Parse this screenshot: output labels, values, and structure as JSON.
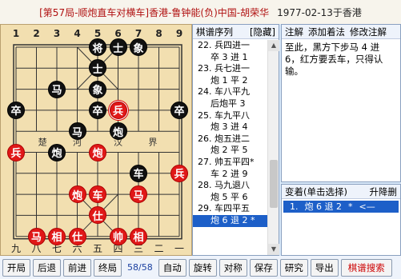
{
  "title": {
    "game": "[第57局-顺炮直车对横车]香港-鲁钟能(负)中国-胡荣华",
    "date": "1977-02-13于香港"
  },
  "board": {
    "file_labels_top": [
      "1",
      "2",
      "3",
      "4",
      "5",
      "6",
      "7",
      "8",
      "9"
    ],
    "file_labels_bottom": [
      "九",
      "八",
      "七",
      "六",
      "五",
      "四",
      "三",
      "二",
      "一"
    ],
    "river_left": [
      "楚",
      "河"
    ],
    "river_right": [
      "汉",
      "界"
    ],
    "pieces": [
      {
        "char": "将",
        "side": "black",
        "col": 4,
        "row": 0
      },
      {
        "char": "士",
        "side": "black",
        "col": 5,
        "row": 0
      },
      {
        "char": "象",
        "side": "black",
        "col": 6,
        "row": 0
      },
      {
        "char": "士",
        "side": "black",
        "col": 4,
        "row": 1
      },
      {
        "char": "马",
        "side": "black",
        "col": 2,
        "row": 2
      },
      {
        "char": "象",
        "side": "black",
        "col": 4,
        "row": 2
      },
      {
        "char": "卒",
        "side": "black",
        "col": 0,
        "row": 3
      },
      {
        "char": "卒",
        "side": "black",
        "col": 4,
        "row": 3
      },
      {
        "char": "兵",
        "side": "red",
        "col": 5,
        "row": 3,
        "last": true
      },
      {
        "char": "卒",
        "side": "black",
        "col": 8,
        "row": 3
      },
      {
        "char": "马",
        "side": "black",
        "col": 3,
        "row": 4
      },
      {
        "char": "炮",
        "side": "black",
        "col": 5,
        "row": 4
      },
      {
        "char": "兵",
        "side": "red",
        "col": 0,
        "row": 5
      },
      {
        "char": "炮",
        "side": "black",
        "col": 2,
        "row": 5
      },
      {
        "char": "炮",
        "side": "red",
        "col": 4,
        "row": 5
      },
      {
        "char": "车",
        "side": "black",
        "col": 6,
        "row": 6
      },
      {
        "char": "兵",
        "side": "red",
        "col": 8,
        "row": 6
      },
      {
        "char": "炮",
        "side": "red",
        "col": 3,
        "row": 7
      },
      {
        "char": "车",
        "side": "red",
        "col": 4,
        "row": 7
      },
      {
        "char": "马",
        "side": "red",
        "col": 6,
        "row": 7
      },
      {
        "char": "仕",
        "side": "red",
        "col": 4,
        "row": 8
      },
      {
        "char": "马",
        "side": "red",
        "col": 1,
        "row": 9
      },
      {
        "char": "相",
        "side": "red",
        "col": 2,
        "row": 9
      },
      {
        "char": "仕",
        "side": "red",
        "col": 3,
        "row": 9
      },
      {
        "char": "帅",
        "side": "red",
        "col": 5,
        "row": 9
      },
      {
        "char": "相",
        "side": "red",
        "col": 6,
        "row": 9
      }
    ]
  },
  "moves_panel": {
    "header_label": "棋谱序列",
    "hide_label": "[隐藏]",
    "rows": [
      {
        "text": "22. 兵四进一",
        "side": "red"
      },
      {
        "text": "卒 3 进 1",
        "side": "black"
      },
      {
        "text": "23. 兵七进一",
        "side": "red"
      },
      {
        "text": "炮 1 平 2",
        "side": "black"
      },
      {
        "text": "24. 车八平九",
        "side": "red"
      },
      {
        "text": "后炮平 3",
        "side": "black"
      },
      {
        "text": "25. 车九平八",
        "side": "red"
      },
      {
        "text": "炮 3 进 4",
        "side": "black"
      },
      {
        "text": "26. 炮五进二",
        "side": "red"
      },
      {
        "text": "炮 2 平 5",
        "side": "black"
      },
      {
        "text": "27. 帅五平四*",
        "side": "red"
      },
      {
        "text": "车 2 进 9",
        "side": "black"
      },
      {
        "text": "28. 马九退八",
        "side": "red"
      },
      {
        "text": "炮 5 平 6",
        "side": "black"
      },
      {
        "text": "29. 车四平五",
        "side": "red"
      },
      {
        "text": "炮 6 退 2 *",
        "side": "black",
        "selected": true
      }
    ]
  },
  "comment_panel": {
    "tabs": [
      "注解",
      "添加着法",
      "修改注解"
    ],
    "text": "至此，黑方下步马 4 进 6，红方要丢车，只得认输。"
  },
  "variation_panel": {
    "label": "变着(单击选择)",
    "action": "升降删",
    "row": {
      "num": "1.",
      "move": "炮 6 退 2",
      "star": "*",
      "arrow": "<—"
    }
  },
  "toolbar": {
    "start": "开局",
    "back": "后退",
    "forward": "前进",
    "end": "终局",
    "counter": "58/58",
    "auto": "自动",
    "rotate": "旋转",
    "mirror": "对称",
    "save": "保存",
    "study": "研究",
    "export": "导出",
    "search": "棋谱搜索"
  },
  "colors": {
    "board": "#f2dfb0",
    "red_piece": "#e01818",
    "black_piece": "#111111",
    "selection": "#1d5fc8",
    "title_red": "#b01010"
  }
}
